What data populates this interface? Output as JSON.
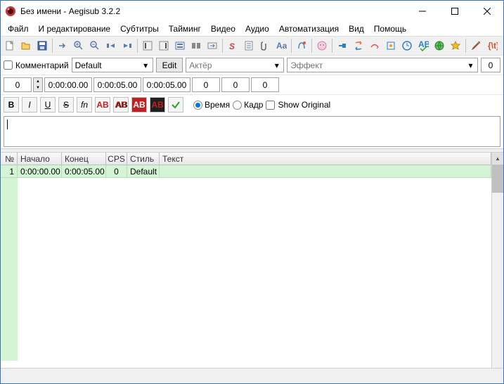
{
  "window": {
    "title": "Без имени - Aegisub 3.2.2"
  },
  "menu": [
    "Файл",
    "И редактирование",
    "Субтитры",
    "Тайминг",
    "Видео",
    "Аудио",
    "Автоматизация",
    "Вид",
    "Помощь"
  ],
  "edit": {
    "comment_label": "Комментарий",
    "style": "Default",
    "edit_label": "Edit",
    "actor_placeholder": "Актёр",
    "effect_placeholder": "Эффект",
    "layer": "0",
    "start": "0:00:00.00",
    "end": "0:00:05.00",
    "duration": "0:00:05.00",
    "margin_l": "0",
    "margin_r": "0",
    "margin_v": "0",
    "time_label": "Время",
    "frame_label": "Кадр",
    "show_original": "Show Original",
    "side_num": "0"
  },
  "grid": {
    "headers": {
      "num": "№",
      "start": "Начало",
      "end": "Конец",
      "cps": "CPS",
      "style": "Стиль",
      "text": "Текст"
    },
    "rows": [
      {
        "num": "1",
        "start": "0:00:00.00",
        "end": "0:00:05.00",
        "cps": "0",
        "style": "Default",
        "text": ""
      }
    ]
  }
}
